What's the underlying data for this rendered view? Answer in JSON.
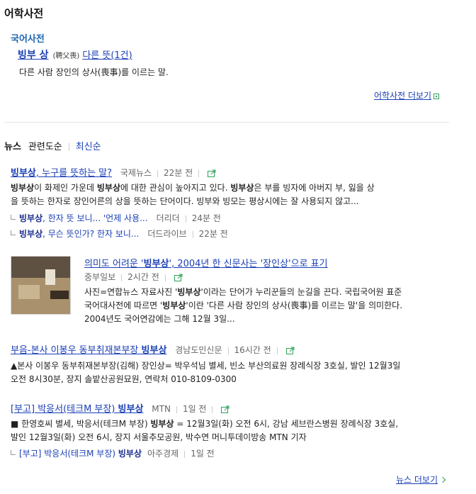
{
  "dict": {
    "section_title": "어학사전",
    "sub_title": "국어사전",
    "word": "빙부 상",
    "hanja": "(聘父喪)",
    "other_meanings": "다른 뜻(1건)",
    "definition": "다른 사람 장인의 상사(喪事)를 이르는 말.",
    "more": "어학사전 더보기"
  },
  "news": {
    "tabs": [
      "뉴스",
      "관련도순",
      "최신순"
    ],
    "items": [
      {
        "title_pre": "",
        "title_bold": "빙부상",
        "title_post": ", 누구를 뜻하는 말?",
        "source": "국제뉴스",
        "time": "22분 전",
        "body_lines": [
          [
            "",
            "빙부상",
            "이 화제인 가운데 ",
            "빙부상",
            "에 대한 관심이 높아지고 있다. ",
            "빙부상",
            "은 부를 빙자에 아버지 부, 잃을 상"
          ],
          [
            "을 뜻하는 한자로 장인어른의 상을 뜻하는 단어이다. 빙부와 빙모는 평상시에는 잘 사용되지 않고..."
          ]
        ],
        "related": [
          {
            "bold": "빙부상",
            "rest": ", 한자 뜻 보니... '언제 사용...",
            "source": "더리더",
            "time": "24분 전"
          },
          {
            "bold": "빙부상",
            "rest": ", 무슨 뜻인가? 한자 보니...",
            "source": "더드라이브",
            "time": "22분 전"
          }
        ]
      },
      {
        "title_pre": "의미도 어려운 '",
        "title_bold": "빙부상",
        "title_post": "', 2004년 한 신문사는 '장인상'으로 표기",
        "source": "중부일보",
        "time": "2시간 전",
        "body_lines": [
          [
            "사진=연합뉴스 자료사진 '",
            "빙부상",
            "'이라는 단어가 누리꾼들의 눈길을 끈다. 국립국어원 표준"
          ],
          [
            "국어대사전에 따르면 '",
            "빙부상",
            "'이란 '다른 사람 장인의 상사(喪事)를 이르는 말'을 의미한다."
          ],
          [
            "2004년도 국어연감에는 그해 12월 3일..."
          ]
        ]
      },
      {
        "title_pre": "부음-본사 이봉우 동부취재본부장 ",
        "title_bold": "빙부상",
        "title_post": "",
        "source": "경남도민신문",
        "time": "16시간 전",
        "body_lines": [
          [
            "▲본사 이봉우 동부취재본부장(김해) 장인상= 박우석님 별세, 빈소 부산의료원 장례식장 3호실, 발인 12월3일"
          ],
          [
            "오전 8시30분, 장지 솔밭산공원묘원, 연락처 010-8109-0300"
          ]
        ]
      },
      {
        "title_pre": "[부고] 박응서(테크M 부장) ",
        "title_bold": "빙부상",
        "title_post": "",
        "source": "MTN",
        "time": "1일 전",
        "body_lines": [
          [
            "■ 한영호씨 별세, 박응서(테크M 부장) ",
            "빙부상",
            " = 12월3일(화) 오전 6시, 강남 세브란스병원 장례식장 3호실,"
          ],
          [
            "발인 12월3일(화) 오전 6시, 장지 서울추모공원, 박수연 머니투데이방송 MTN 기자"
          ]
        ],
        "related": [
          {
            "pre": "[부고] 박응서(테크M 부장) ",
            "bold": "빙부상",
            "rest": "",
            "source": "아주경제",
            "time": "1일 전"
          }
        ]
      }
    ],
    "more": "뉴스 더보기"
  },
  "colors": {
    "link": "#1a3fb5",
    "accent_green": "#2ea05a",
    "title_blue": "#1d64b0"
  }
}
